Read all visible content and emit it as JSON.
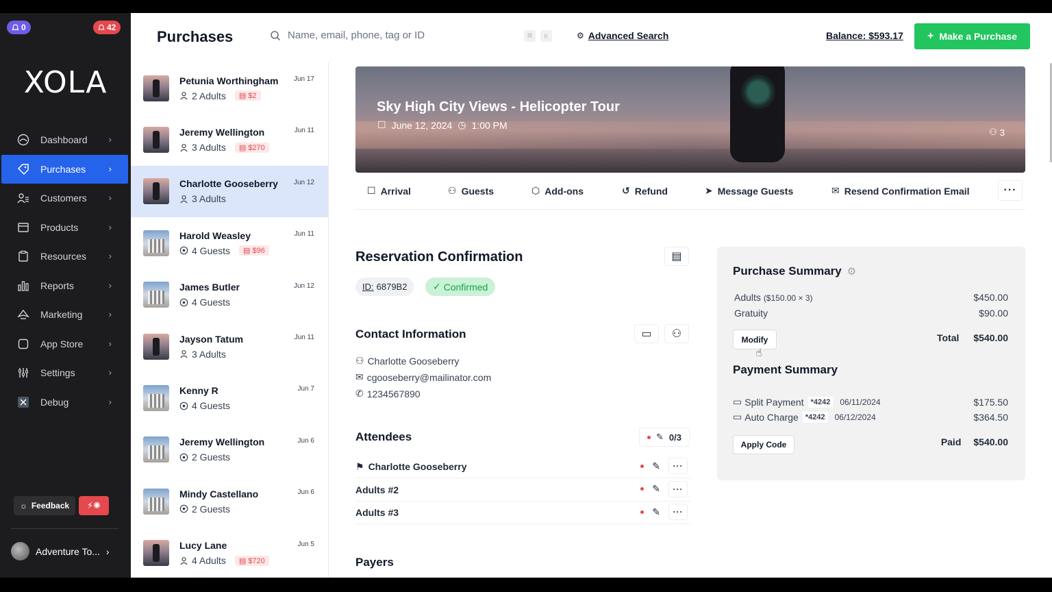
{
  "badges": {
    "notifications": "0",
    "alerts": "42"
  },
  "brand": {
    "logo": "XOLA"
  },
  "sidebar": {
    "items": [
      {
        "label": "Dashboard",
        "icon": "dashboard-icon"
      },
      {
        "label": "Purchases",
        "icon": "purchases-icon",
        "active": true
      },
      {
        "label": "Customers",
        "icon": "customers-icon"
      },
      {
        "label": "Products",
        "icon": "products-icon"
      },
      {
        "label": "Resources",
        "icon": "resources-icon"
      },
      {
        "label": "Reports",
        "icon": "reports-icon"
      },
      {
        "label": "Marketing",
        "icon": "marketing-icon"
      },
      {
        "label": "App Store",
        "icon": "app-store-icon"
      },
      {
        "label": "Settings",
        "icon": "settings-icon"
      },
      {
        "label": "Debug",
        "icon": "debug-icon"
      }
    ],
    "feedback_label": "Feedback",
    "account_name": "Adventure To..."
  },
  "header": {
    "title": "Purchases",
    "search_placeholder": "Name, email, phone, tag or ID",
    "advanced_search": "Advanced Search",
    "balance": "Balance: $593.17",
    "make_purchase": "Make a Purchase"
  },
  "purchases": [
    {
      "name": "Petunia Worthingham",
      "date": "Jun 17",
      "party": "2 Adults",
      "due": "$2",
      "thumb": "heli"
    },
    {
      "name": "Jeremy Wellington",
      "date": "Jun 11",
      "party": "3 Adults",
      "due": "$270",
      "thumb": "heli"
    },
    {
      "name": "Charlotte Gooseberry",
      "date": "Jun 12",
      "party": "3 Adults",
      "due": "",
      "thumb": "heli",
      "selected": true
    },
    {
      "name": "Harold Weasley",
      "date": "Jun 11",
      "party": "4 Guests",
      "due": "$96",
      "thumb": "bldg"
    },
    {
      "name": "James Butler",
      "date": "Jun 12",
      "party": "4 Guests",
      "due": "",
      "thumb": "bldg"
    },
    {
      "name": "Jayson Tatum",
      "date": "Jun 11",
      "party": "3 Adults",
      "due": "",
      "thumb": "heli"
    },
    {
      "name": "Kenny R",
      "date": "Jun 7",
      "party": "4 Guests",
      "due": "",
      "thumb": "bldg"
    },
    {
      "name": "Jeremy Wellington",
      "date": "Jun 6",
      "party": "2 Guests",
      "due": "",
      "thumb": "bldg"
    },
    {
      "name": "Mindy Castellano",
      "date": "Jun 6",
      "party": "2 Guests",
      "due": "",
      "thumb": "bldg"
    },
    {
      "name": "Lucy Lane",
      "date": "Jun 5",
      "party": "4 Adults",
      "due": "$720",
      "thumb": "heli"
    }
  ],
  "event": {
    "title": "Sky High City Views - Helicopter Tour",
    "date": "June 12, 2024",
    "time": "1:00 PM",
    "guest_count": "3"
  },
  "actions": {
    "arrival": "Arrival",
    "guests": "Guests",
    "addons": "Add-ons",
    "refund": "Refund",
    "message": "Message Guests",
    "resend": "Resend Confirmation Email"
  },
  "reservation": {
    "title": "Reservation Confirmation",
    "id_label": "ID:",
    "id_value": "6879B2",
    "status": "Confirmed"
  },
  "contact": {
    "title": "Contact Information",
    "name": "Charlotte Gooseberry",
    "email": "cgooseberry@mailinator.com",
    "phone": "1234567890"
  },
  "attendees": {
    "title": "Attendees",
    "count": "0/3",
    "list": [
      "Charlotte Gooseberry",
      "Adults #2",
      "Adults #3"
    ]
  },
  "payers": {
    "title": "Payers"
  },
  "purchase_summary": {
    "title": "Purchase Summary",
    "adults_label": "Adults",
    "adults_detail": "($150.00 × 3)",
    "adults_amount": "$450.00",
    "gratuity_label": "Gratuity",
    "gratuity_amount": "$90.00",
    "modify": "Modify",
    "total_label": "Total",
    "total_amount": "$540.00"
  },
  "payment_summary": {
    "title": "Payment Summary",
    "payments": [
      {
        "method": "Split Payment",
        "card": "*4242",
        "date": "06/11/2024",
        "amount": "$175.50"
      },
      {
        "method": "Auto Charge",
        "card": "*4242",
        "date": "06/12/2024",
        "amount": "$364.50"
      }
    ],
    "apply_code": "Apply Code",
    "paid_label": "Paid",
    "paid_amount": "$540.00"
  }
}
